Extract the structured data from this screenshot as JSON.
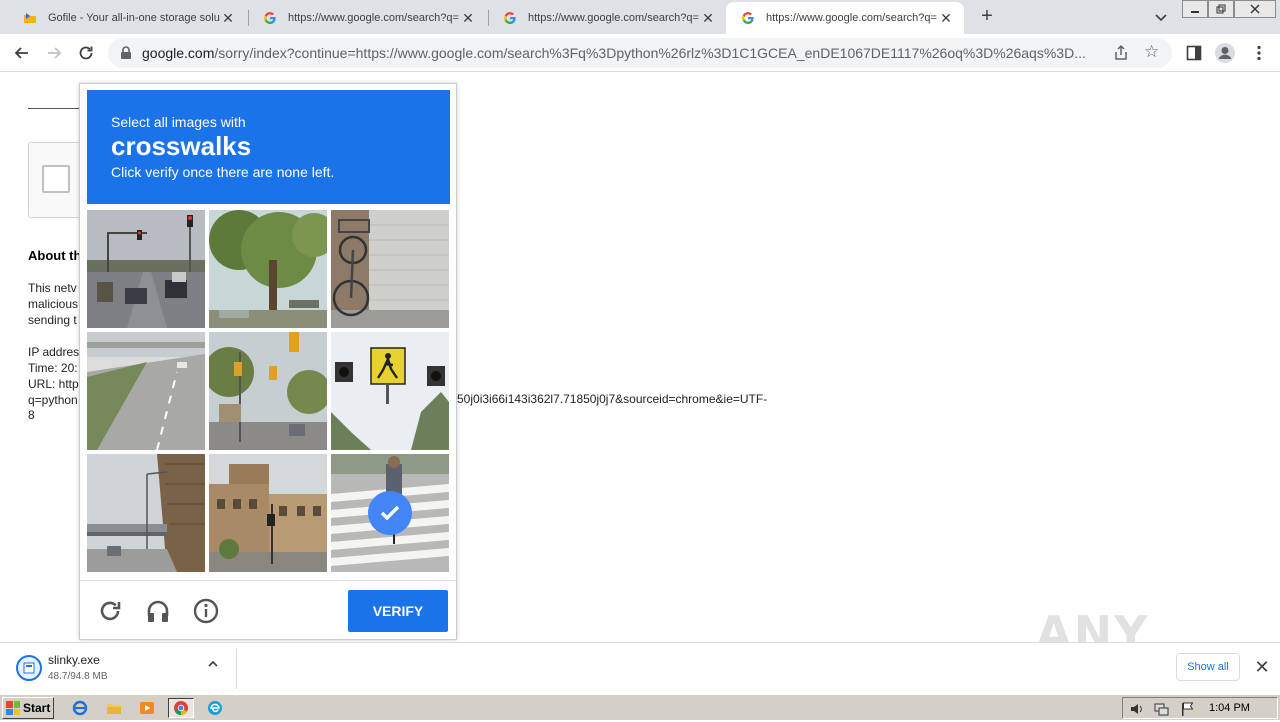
{
  "tabs": [
    {
      "title": "Gofile - Your all-in-one storage soluti",
      "close": "✕",
      "favicon": "gofile-icon"
    },
    {
      "title": "https://www.google.com/search?q=",
      "close": "✕",
      "favicon": "google-icon"
    },
    {
      "title": "https://www.google.com/search?q=",
      "close": "✕",
      "favicon": "google-icon"
    },
    {
      "title": "https://www.google.com/search?q=",
      "close": "✕",
      "favicon": "google-icon",
      "active": true
    }
  ],
  "newtab": "+",
  "address": {
    "host": "google.com",
    "path": "/sorry/index?continue=https://www.google.com/search%3Fq%3Dpython%26rlz%3D1C1GCEA_enDE1067DE1117%26oq%3D%26aqs%3D..."
  },
  "page": {
    "about_title": "About th",
    "about_lines": [
      "This netv",
      "malicious",
      "sending t",
      "",
      "IP addres",
      "Time: 20:",
      "URL: http",
      "q=python"
    ],
    "url_tail": "50j0i3i66i143i362l7.71850j0j7&sourceid=chrome&ie=UTF-",
    "url_eight": "8"
  },
  "captcha": {
    "line1": "Select all images with",
    "keyword": "crosswalks",
    "line3": "Click verify once there are none left.",
    "verify_label": "VERIFY",
    "tiles": [
      {
        "scene": "road-traffic-lights",
        "selected": false
      },
      {
        "scene": "trees-park",
        "selected": false
      },
      {
        "scene": "bicycle-wall",
        "selected": false
      },
      {
        "scene": "highway",
        "selected": false
      },
      {
        "scene": "intersection-lights",
        "selected": false
      },
      {
        "scene": "pedestrian-sign",
        "selected": false
      },
      {
        "scene": "overpass",
        "selected": false
      },
      {
        "scene": "buildings-street",
        "selected": false
      },
      {
        "scene": "crosswalk-cyclist",
        "selected": true
      }
    ]
  },
  "download": {
    "filename": "slinky.exe",
    "progress": "48.7/94.8 MB",
    "show_all": "Show all"
  },
  "watermark": "ANY RUN",
  "taskbar": {
    "start": "Start",
    "clock": "1:04 PM"
  },
  "colors": {
    "accent": "#1a73e8",
    "tabstrip": "#dee1e6",
    "taskbar": "#d4d0c8"
  }
}
